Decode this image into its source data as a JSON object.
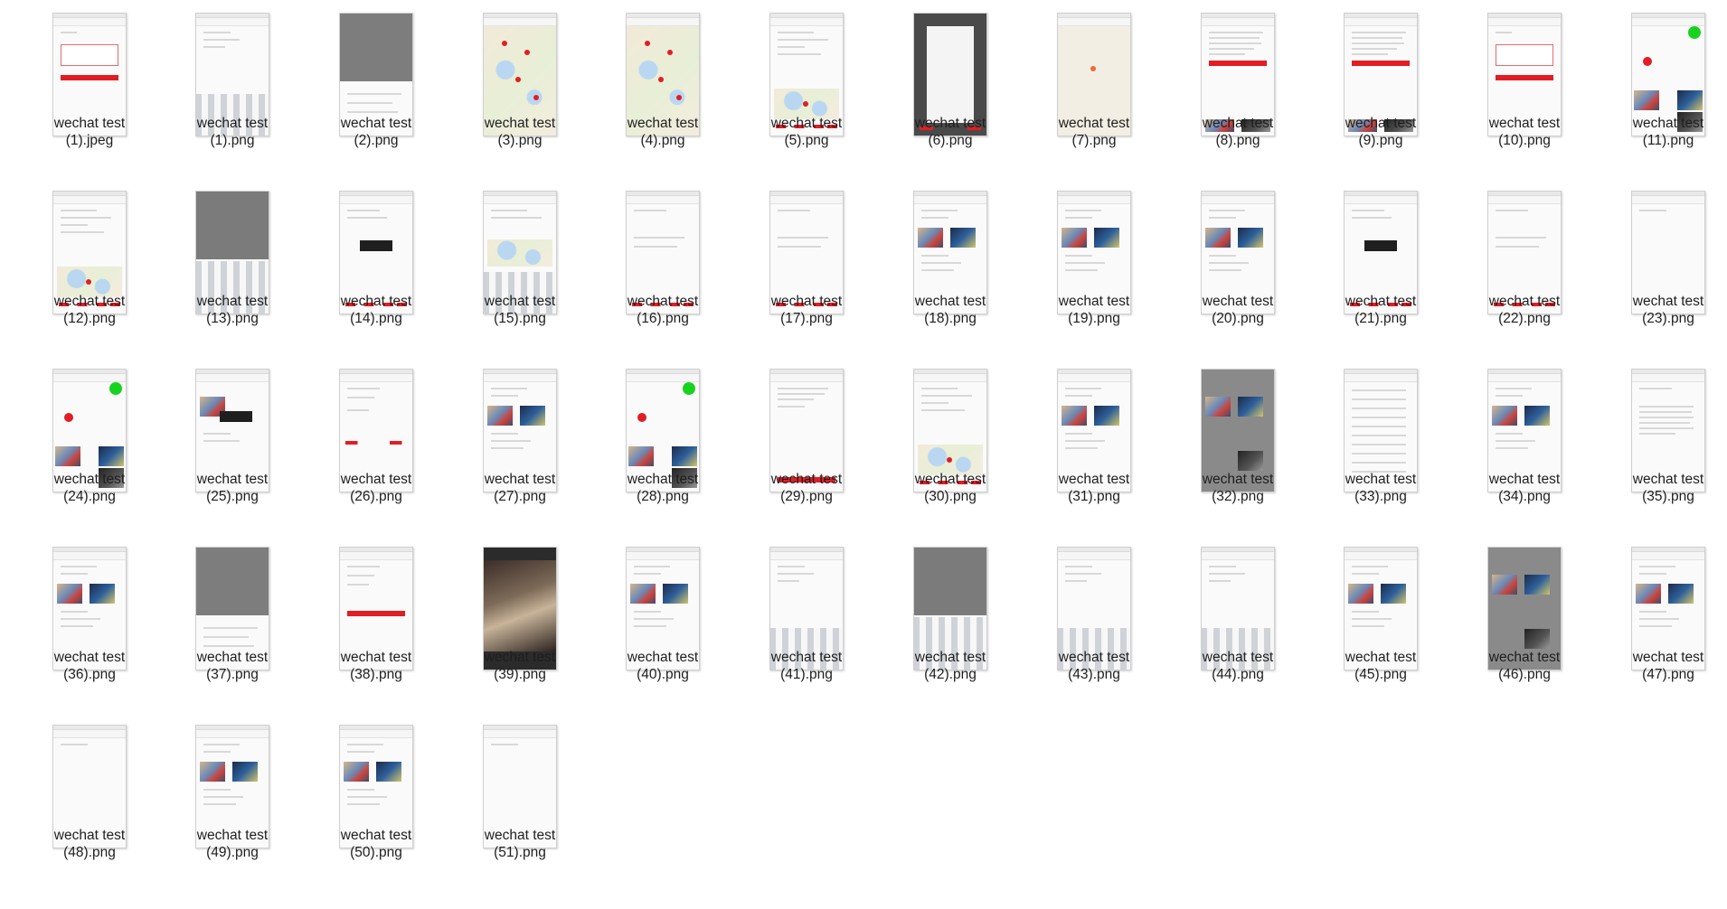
{
  "files": [
    {
      "line1": "wechat test",
      "line2": "(1).jpeg",
      "kind": "form"
    },
    {
      "line1": "wechat test",
      "line2": "(1).png",
      "kind": "keyboard"
    },
    {
      "line1": "wechat test",
      "line2": "(2).png",
      "kind": "dim"
    },
    {
      "line1": "wechat test",
      "line2": "(3).png",
      "kind": "map"
    },
    {
      "line1": "wechat test",
      "line2": "(4).png",
      "kind": "map"
    },
    {
      "line1": "wechat test",
      "line2": "(5).png",
      "kind": "mapsmall"
    },
    {
      "line1": "wechat test",
      "line2": "(6).png",
      "kind": "darkpanel"
    },
    {
      "line1": "wechat test",
      "line2": "(7).png",
      "kind": "blankmap"
    },
    {
      "line1": "wechat test",
      "line2": "(8).png",
      "kind": "article"
    },
    {
      "line1": "wechat test",
      "line2": "(9).png",
      "kind": "article"
    },
    {
      "line1": "wechat test",
      "line2": "(10).png",
      "kind": "form"
    },
    {
      "line1": "wechat test",
      "line2": "(11).png",
      "kind": "feed"
    },
    {
      "line1": "wechat test",
      "line2": "(12).png",
      "kind": "mapsmall"
    },
    {
      "line1": "wechat test",
      "line2": "(13).png",
      "kind": "dimkeyboard"
    },
    {
      "line1": "wechat test",
      "line2": "(14).png",
      "kind": "toast"
    },
    {
      "line1": "wechat test",
      "line2": "(15).png",
      "kind": "mapkeyboard"
    },
    {
      "line1": "wechat test",
      "line2": "(16).png",
      "kind": "redbtns"
    },
    {
      "line1": "wechat test",
      "line2": "(17).png",
      "kind": "redbtns"
    },
    {
      "line1": "wechat test",
      "line2": "(18).png",
      "kind": "photos"
    },
    {
      "line1": "wechat test",
      "line2": "(19).png",
      "kind": "photos"
    },
    {
      "line1": "wechat test",
      "line2": "(20).png",
      "kind": "photos"
    },
    {
      "line1": "wechat test",
      "line2": "(21).png",
      "kind": "toast"
    },
    {
      "line1": "wechat test",
      "line2": "(22).png",
      "kind": "redbtns"
    },
    {
      "line1": "wechat test",
      "line2": "(23).png",
      "kind": "blank"
    },
    {
      "line1": "wechat test",
      "line2": "(24).png",
      "kind": "feed"
    },
    {
      "line1": "wechat test",
      "line2": "(25).png",
      "kind": "toastphoto"
    },
    {
      "line1": "wechat test",
      "line2": "(26).png",
      "kind": "redbtns2"
    },
    {
      "line1": "wechat test",
      "line2": "(27).png",
      "kind": "photos"
    },
    {
      "line1": "wechat test",
      "line2": "(28).png",
      "kind": "feed"
    },
    {
      "line1": "wechat test",
      "line2": "(29).png",
      "kind": "textred"
    },
    {
      "line1": "wechat test",
      "line2": "(30).png",
      "kind": "mapsmall"
    },
    {
      "line1": "wechat test",
      "line2": "(31).png",
      "kind": "photos"
    },
    {
      "line1": "wechat test",
      "line2": "(32).png",
      "kind": "dimphotos"
    },
    {
      "line1": "wechat test",
      "line2": "(33).png",
      "kind": "table"
    },
    {
      "line1": "wechat test",
      "line2": "(34).png",
      "kind": "photos"
    },
    {
      "line1": "wechat test",
      "line2": "(35).png",
      "kind": "text"
    },
    {
      "line1": "wechat test",
      "line2": "(36).png",
      "kind": "photos"
    },
    {
      "line1": "wechat test",
      "line2": "(37).png",
      "kind": "dim"
    },
    {
      "line1": "wechat test",
      "line2": "(38).png",
      "kind": "redbar"
    },
    {
      "line1": "wechat test",
      "line2": "(39).png",
      "kind": "video"
    },
    {
      "line1": "wechat test",
      "line2": "(40).png",
      "kind": "photos"
    },
    {
      "line1": "wechat test",
      "line2": "(41).png",
      "kind": "keyboard"
    },
    {
      "line1": "wechat test",
      "line2": "(42).png",
      "kind": "dimkeyboard"
    },
    {
      "line1": "wechat test",
      "line2": "(43).png",
      "kind": "keyboard"
    },
    {
      "line1": "wechat test",
      "line2": "(44).png",
      "kind": "keyboard"
    },
    {
      "line1": "wechat test",
      "line2": "(45).png",
      "kind": "photos"
    },
    {
      "line1": "wechat test",
      "line2": "(46).png",
      "kind": "dimphotos"
    },
    {
      "line1": "wechat test",
      "line2": "(47).png",
      "kind": "photos"
    },
    {
      "line1": "wechat test",
      "line2": "(48).png",
      "kind": "blank"
    },
    {
      "line1": "wechat test",
      "line2": "(49).png",
      "kind": "photos"
    },
    {
      "line1": "wechat test",
      "line2": "(50).png",
      "kind": "photos"
    },
    {
      "line1": "wechat test",
      "line2": "(51).png",
      "kind": "blank"
    }
  ],
  "colors": {
    "accent_red": "#e21d24",
    "green_dot": "#17d31f",
    "label_text": "#1e1e1e"
  }
}
